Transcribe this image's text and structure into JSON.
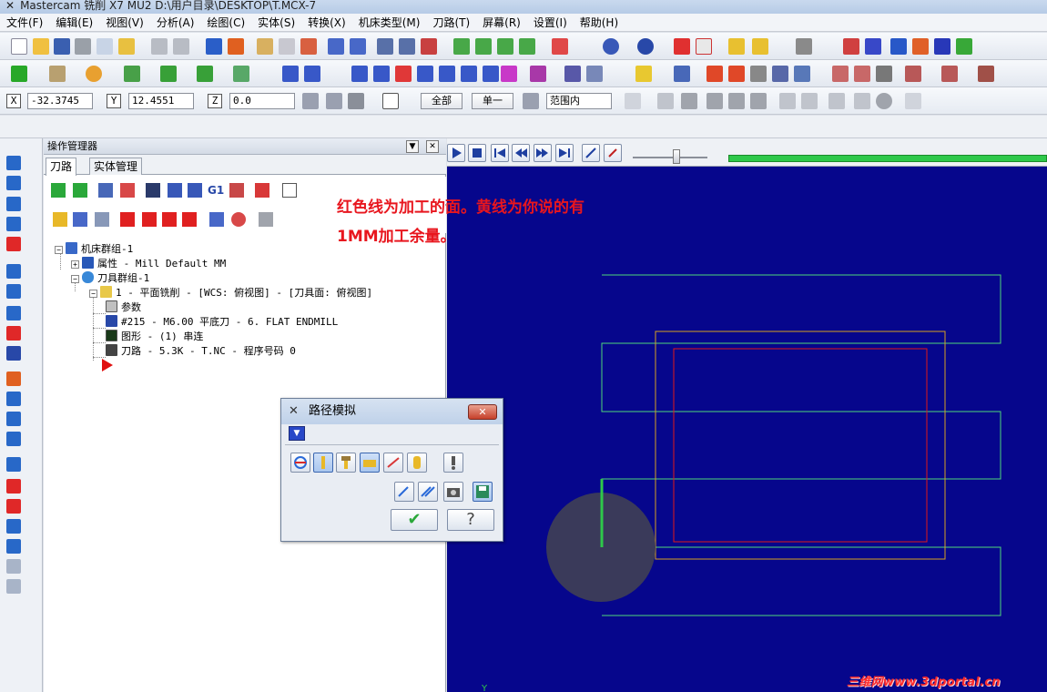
{
  "window": {
    "title": "Mastercam 铣削 X7 MU2  D:\\用户目录\\DESKTOP\\T.MCX-7"
  },
  "menu": [
    "文件(F)",
    "编辑(E)",
    "视图(V)",
    "分析(A)",
    "绘图(C)",
    "实体(S)",
    "转换(X)",
    "机床类型(M)",
    "刀路(T)",
    "屏幕(R)",
    "设置(I)",
    "帮助(H)"
  ],
  "coords": {
    "x_label": "X",
    "x_value": "-32.3745",
    "y_label": "Y",
    "y_value": "12.4551",
    "z_label": "Z",
    "z_value": "0.0"
  },
  "select_bar": {
    "all_label": "全部",
    "single_label": "单一",
    "range_value": "范围内"
  },
  "op_manager": {
    "title": "操作管理器",
    "tabs": [
      "刀路",
      "实体管理"
    ],
    "g1_label": "G1",
    "tree": {
      "machine_group": "机床群组-1",
      "properties": "属性 - Mill Default MM",
      "toolpath_group": "刀具群组-1",
      "operation": "1 - 平面铣削 - [WCS: 俯视图] - [刀具面: 俯视图]",
      "params": "参数",
      "tool": "#215 - M6.00 平底刀 -    6. FLAT ENDMILL",
      "geometry": "图形 - (1) 串连",
      "toolpath": "刀路 - 5.3K - T.NC - 程序号码 0"
    }
  },
  "sim_dialog": {
    "title": "路径模拟",
    "close_label": "✕",
    "ok_glyph": "✔",
    "help_glyph": "?"
  },
  "annotation": {
    "line1": "红色线为加工的面。黄线为你说的有",
    "line2": "1MM加工余量。"
  },
  "viewport": {
    "axis_label": "Y",
    "background": "#06068c",
    "toolpath_color": "#4fd67a",
    "stock_color": "#d6a020",
    "face_color": "#e01818",
    "tool_color": "#3a3a5a"
  },
  "watermark": "三维网www.3dportal.cn"
}
